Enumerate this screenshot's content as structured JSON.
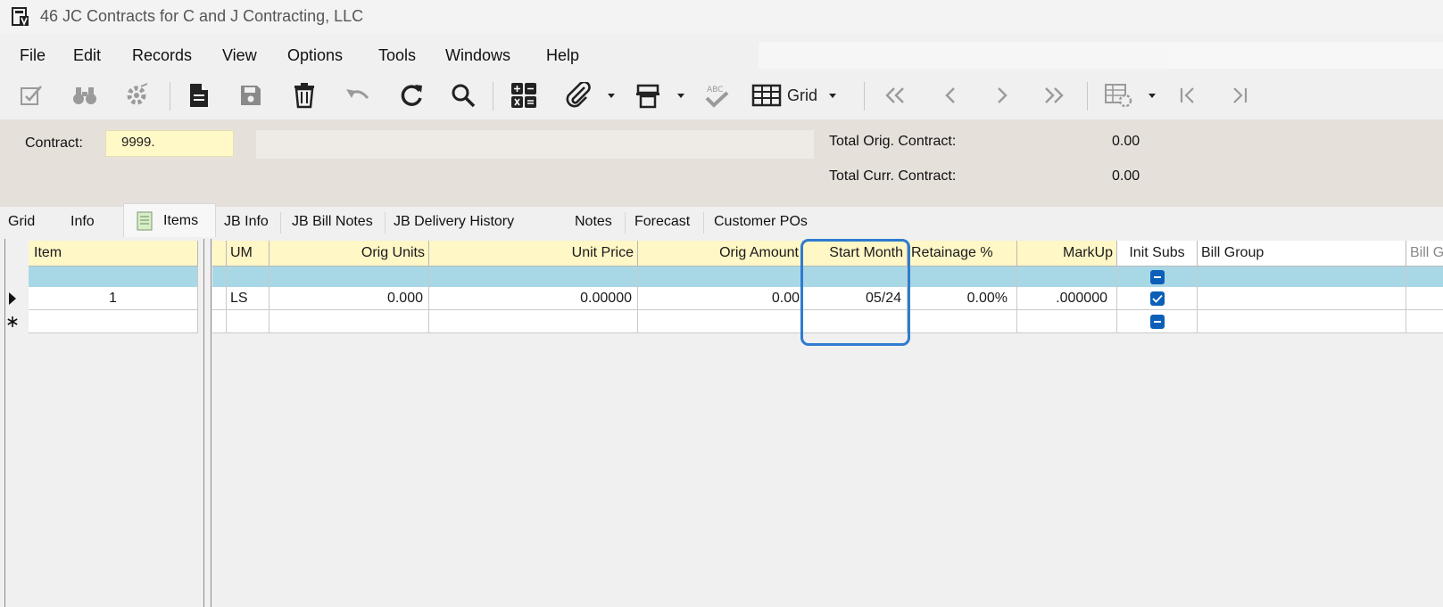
{
  "window": {
    "title": "46 JC Contracts for C and J Contracting, LLC",
    "icon": "vista-app-icon"
  },
  "menu": [
    "File",
    "Edit",
    "Records",
    "View",
    "Options",
    "Tools",
    "Windows",
    "Help"
  ],
  "toolbar": {
    "icons": [
      "edit-check-icon",
      "binoculars-icon",
      "settings-icon",
      "new-doc-icon",
      "save-icon",
      "delete-icon",
      "undo-icon",
      "refresh-icon",
      "search-icon",
      "calculator-icon",
      "attachment-icon",
      "print-icon",
      "spellcheck-icon",
      "grid-icon",
      "first-record-icon",
      "previous-icon",
      "next-icon",
      "last-record-icon",
      "grid-settings-icon",
      "go-first-icon",
      "go-last-icon"
    ],
    "grid_label": "Grid"
  },
  "header": {
    "contract_label": "Contract:",
    "contract_value": "9999.",
    "total_orig_label": "Total Orig. Contract:",
    "total_orig_value": "0.00",
    "total_curr_label": "Total Curr. Contract:",
    "total_curr_value": "0.00"
  },
  "tabs": [
    "Grid",
    "Info",
    "Items",
    "JB Info",
    "JB Bill Notes",
    "JB Delivery History",
    "Notes",
    "Forecast",
    "Customer POs"
  ],
  "active_tab": "Items",
  "grid": {
    "columns": [
      "Item",
      "UM",
      "Orig Units",
      "Unit Price",
      "Orig Amount",
      "Start Month",
      "Retainage %",
      "MarkUp",
      "Init Subs",
      "Bill Group",
      "Bill G"
    ],
    "rows": [
      {
        "item": "1",
        "um": "LS",
        "orig_units": "0.000",
        "unit_price": "0.00000",
        "orig_amount": "0.00",
        "start_month": "05/24",
        "retainage": "0.00%",
        "markup": ".000000",
        "init_subs": true,
        "bill_group": ""
      }
    ],
    "new_row_init_subs": "indeterminate"
  },
  "colors": {
    "header_yellow": "#fff7c6",
    "filter_blue": "#a8d8e6",
    "highlight": "#2e7bd1",
    "panel": "#e6e0db"
  }
}
